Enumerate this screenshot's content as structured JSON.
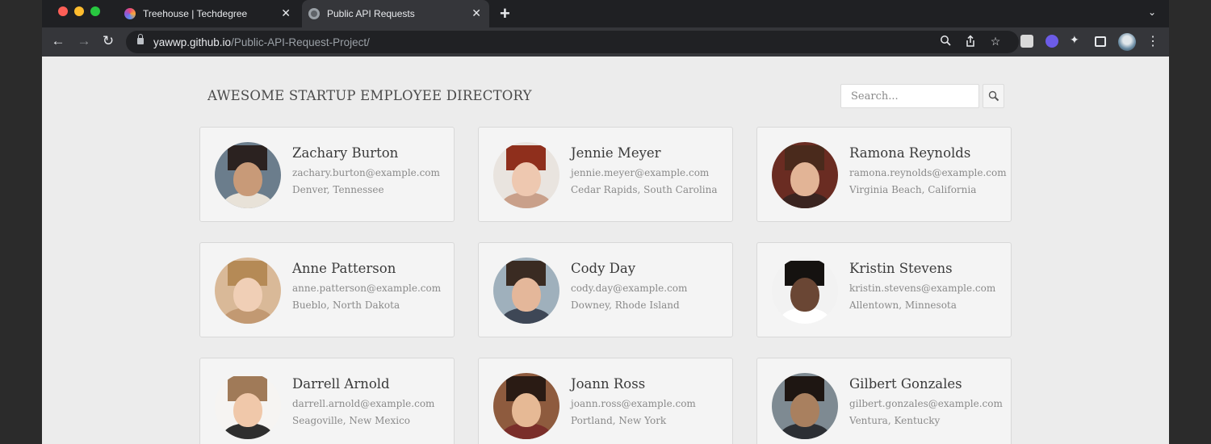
{
  "browser": {
    "tabs": [
      {
        "title": "Treehouse | Techdegree",
        "close": "✕"
      },
      {
        "title": "Public API Requests",
        "close": "✕"
      }
    ],
    "new_tab": "+",
    "tab_menu": "⌄",
    "url_host": "yawwp.github.io",
    "url_path": "/Public-API-Request-Project/"
  },
  "page": {
    "title": "AWESOME STARTUP EMPLOYEE DIRECTORY",
    "search": {
      "placeholder": "Search...",
      "value": ""
    }
  },
  "employees": [
    {
      "name": "Zachary Burton",
      "email": "zachary.burton@example.com",
      "location": "Denver, Tennessee",
      "skin": "#c89a78",
      "hair": "#2b2220",
      "bg": "#6b7d8c",
      "shirt": "#e8e2d8"
    },
    {
      "name": "Jennie Meyer",
      "email": "jennie.meyer@example.com",
      "location": "Cedar Rapids, South Carolina",
      "skin": "#eec8b0",
      "hair": "#8f2f1c",
      "bg": "#e9e4df",
      "shirt": "#c9a08a"
    },
    {
      "name": "Ramona Reynolds",
      "email": "ramona.reynolds@example.com",
      "location": "Virginia Beach, California",
      "skin": "#e2b496",
      "hair": "#4a2a1c",
      "bg": "#6a2c22",
      "shirt": "#3a2420"
    },
    {
      "name": "Anne Patterson",
      "email": "anne.patterson@example.com",
      "location": "Bueblo, North Dakota",
      "skin": "#f0cfb6",
      "hair": "#b58a56",
      "bg": "#d9b998",
      "shirt": "#c29972"
    },
    {
      "name": "Cody Day",
      "email": "cody.day@example.com",
      "location": "Downey, Rhode Island",
      "skin": "#e4b79a",
      "hair": "#3a2b22",
      "bg": "#9fb0bc",
      "shirt": "#3e4756"
    },
    {
      "name": "Kristin Stevens",
      "email": "kristin.stevens@example.com",
      "location": "Allentown, Minnesota",
      "skin": "#6a4634",
      "hair": "#151210",
      "bg": "#f2f2f2",
      "shirt": "#ffffff"
    },
    {
      "name": "Darrell Arnold",
      "email": "darrell.arnold@example.com",
      "location": "Seagoville, New Mexico",
      "skin": "#f0c8aa",
      "hair": "#a07a58",
      "bg": "#f6f4f2",
      "shirt": "#2e2e2e"
    },
    {
      "name": "Joann Ross",
      "email": "joann.ross@example.com",
      "location": "Portland, New York",
      "skin": "#e6b995",
      "hair": "#2a1b14",
      "bg": "#8e5b3e",
      "shirt": "#7a2e2a"
    },
    {
      "name": "Gilbert Gonzales",
      "email": "gilbert.gonzales@example.com",
      "location": "Ventura, Kentucky",
      "skin": "#a9805f",
      "hair": "#1e1612",
      "bg": "#7e8a92",
      "shirt": "#2c2f34"
    }
  ]
}
